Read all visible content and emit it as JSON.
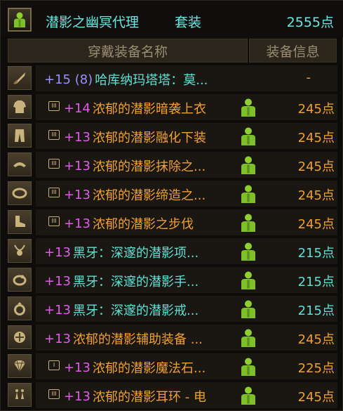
{
  "header": {
    "title": "潜影之幽冥代理",
    "set_label": "套装",
    "points": "2555点",
    "icon": "person-icon"
  },
  "columns": {
    "name": "穿戴装备名称",
    "info": "装备信息"
  },
  "items": [
    {
      "slot_icon": "weapon-icon",
      "tag": "",
      "level": "+15 (8)",
      "name": "哈库纳玛塔塔：莫...",
      "points": "-",
      "level_color": "blue",
      "name_color": "cyan"
    },
    {
      "slot_icon": "top-armor-icon",
      "tag": "III",
      "level": "+14",
      "name": "浓郁的潜影暗袭上衣",
      "points": "245点",
      "level_color": "magenta",
      "name_color": "orange"
    },
    {
      "slot_icon": "pants-icon",
      "tag": "III",
      "level": "+13",
      "name": "浓郁的潜影融化下装",
      "points": "245点",
      "level_color": "magenta",
      "name_color": "orange"
    },
    {
      "slot_icon": "shoulder-icon",
      "tag": "III",
      "level": "+13",
      "name": "浓郁的潜影抹除之...",
      "points": "245点",
      "level_color": "magenta",
      "name_color": "orange"
    },
    {
      "slot_icon": "belt-icon",
      "tag": "III",
      "level": "+13",
      "name": "浓郁的潜影缔造之...",
      "points": "245点",
      "level_color": "magenta",
      "name_color": "orange"
    },
    {
      "slot_icon": "shoes-icon",
      "tag": "III",
      "level": "+13",
      "name": "浓郁的潜影之步伐",
      "points": "245点",
      "level_color": "magenta",
      "name_color": "orange"
    },
    {
      "slot_icon": "necklace-icon",
      "tag": "",
      "level": "+13",
      "name": "黑牙：深邃的潜影项...",
      "points": "215点",
      "level_color": "magenta",
      "name_color": "cyan"
    },
    {
      "slot_icon": "bracelet-icon",
      "tag": "",
      "level": "+13",
      "name": "黑牙：深邃的潜影手...",
      "points": "215点",
      "level_color": "magenta",
      "name_color": "cyan"
    },
    {
      "slot_icon": "ring-icon",
      "tag": "",
      "level": "+13",
      "name": "黑牙：深邃的潜影戒...",
      "points": "215点",
      "level_color": "magenta",
      "name_color": "cyan"
    },
    {
      "slot_icon": "support-icon",
      "tag": "",
      "level": "+13",
      "name": "浓郁的潜影辅助装备 ...",
      "points": "245点",
      "level_color": "magenta",
      "name_color": "orange"
    },
    {
      "slot_icon": "magic-stone-icon",
      "tag": "I",
      "level": "+13",
      "name": "浓郁的潜影魔法石...",
      "points": "225点",
      "level_color": "magenta",
      "name_color": "orange"
    },
    {
      "slot_icon": "earring-icon",
      "tag": "III",
      "level": "+13",
      "name": "浓郁的潜影耳环 - 电",
      "points": "245点",
      "level_color": "magenta",
      "name_color": "orange"
    }
  ],
  "colors": {
    "cyan": "#5fe0d5",
    "orange": "#f0a030",
    "magenta": "#e05bea",
    "blue": "#9a90ff",
    "green_person": "#7fbf2a"
  }
}
